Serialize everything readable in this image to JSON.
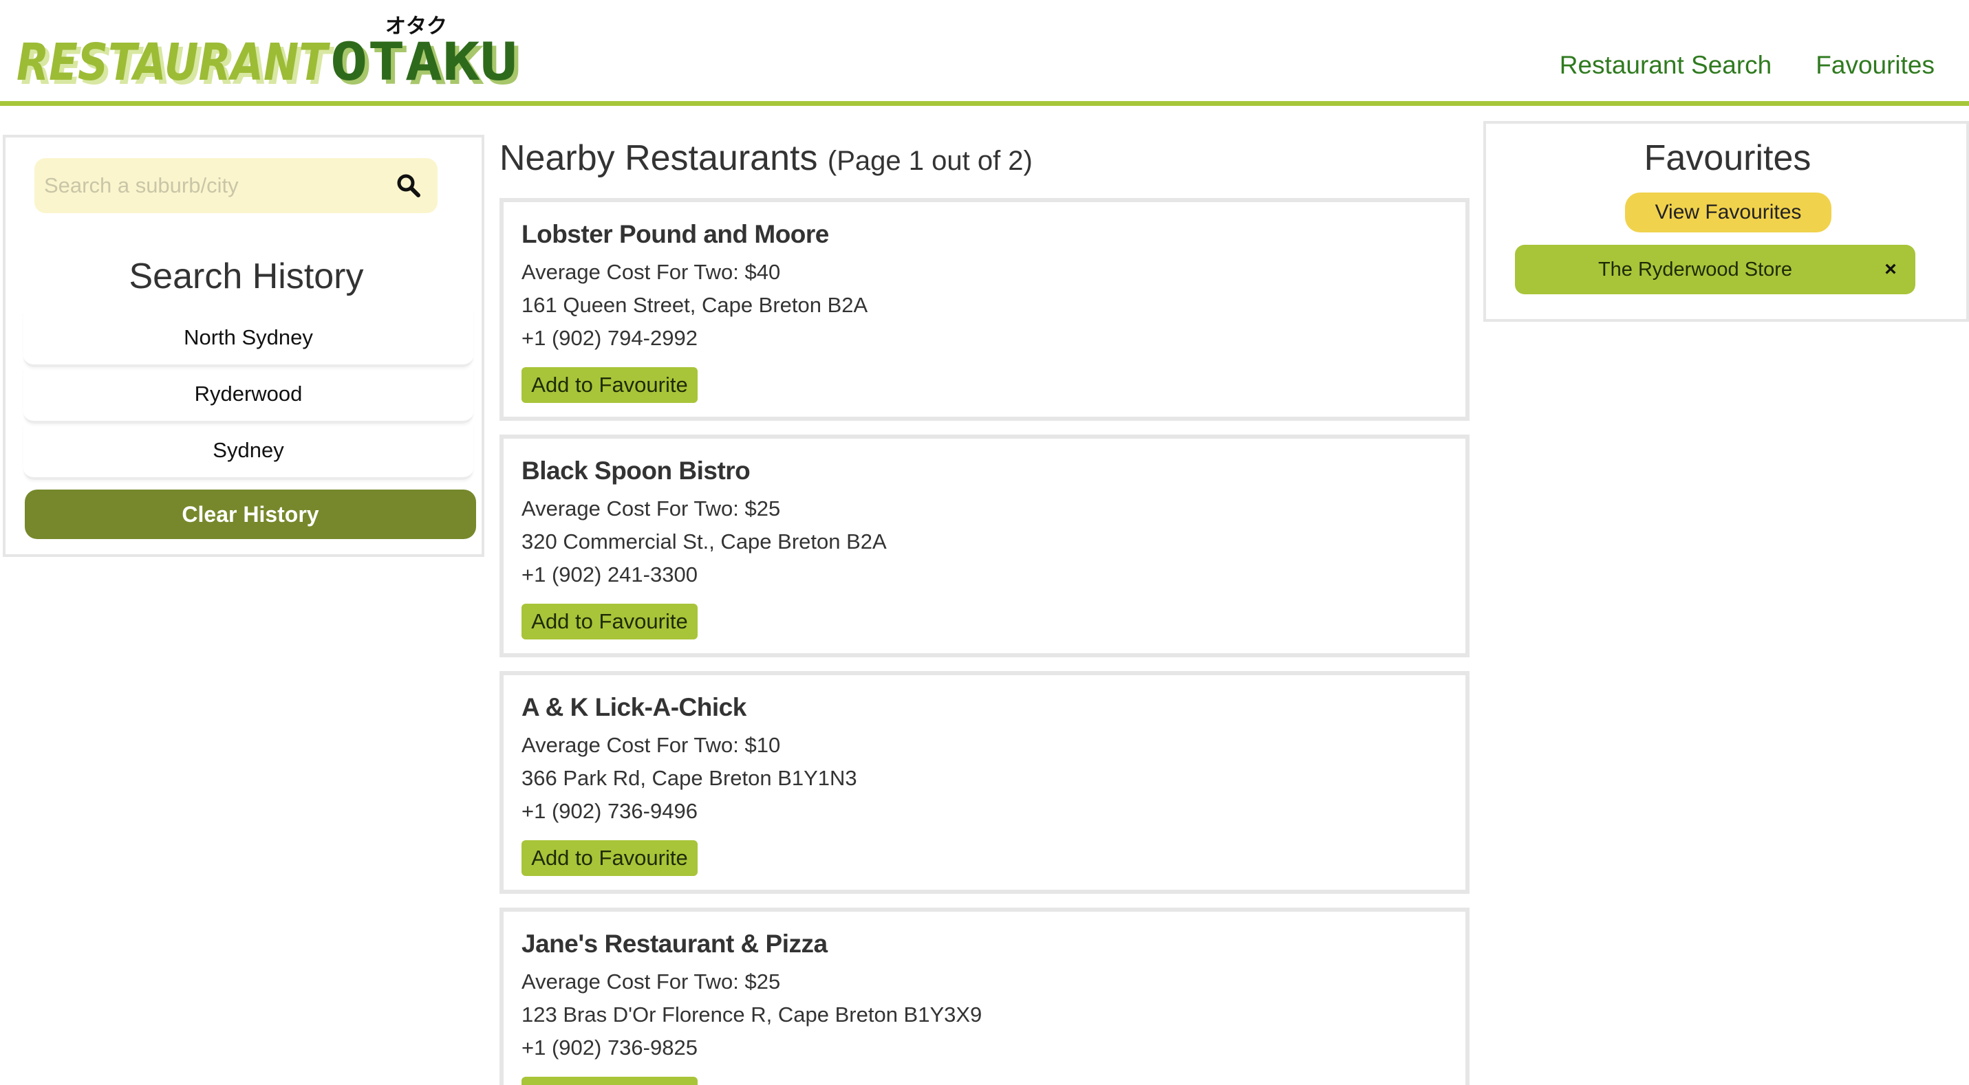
{
  "header": {
    "logo": {
      "main": "RESTAURANT",
      "accent": "OTAKU",
      "kana": "オタク"
    },
    "nav": [
      "Restaurant Search",
      "Favourites"
    ]
  },
  "sidebar": {
    "search_placeholder": "Search a suburb/city",
    "history_title": "Search History",
    "history": [
      "North Sydney",
      "Ryderwood",
      "Sydney"
    ],
    "clear_label": "Clear History"
  },
  "main": {
    "title": "Nearby Restaurants",
    "page_info": "(Page 1 out of 2)",
    "add_label": "Add to Favourite",
    "restaurants": [
      {
        "name": "Lobster Pound and Moore",
        "cost": "Average Cost For Two: $40",
        "address": "161 Queen Street, Cape Breton B2A",
        "phone": "+1 (902) 794-2992"
      },
      {
        "name": "Black Spoon Bistro",
        "cost": "Average Cost For Two: $25",
        "address": "320 Commercial St., Cape Breton B2A",
        "phone": "+1 (902) 241-3300"
      },
      {
        "name": "A & K Lick-A-Chick",
        "cost": "Average Cost For Two: $10",
        "address": "366 Park Rd, Cape Breton B1Y1N3",
        "phone": "+1 (902) 736-9496"
      },
      {
        "name": "Jane's Restaurant & Pizza",
        "cost": "Average Cost For Two: $25",
        "address": "123 Bras D'Or Florence R, Cape Breton B1Y3X9",
        "phone": "+1 (902) 736-9825"
      }
    ]
  },
  "favourites": {
    "title": "Favourites",
    "view_label": "View Favourites",
    "items": [
      {
        "name": "The Ryderwood Store",
        "remove": "×"
      }
    ]
  },
  "colors": {
    "brand_green": "#a6c73a",
    "nav_green": "#2f7a1f",
    "clear_button": "#76882b",
    "view_button": "#f1d24c",
    "search_bg": "#fbf5cd"
  }
}
